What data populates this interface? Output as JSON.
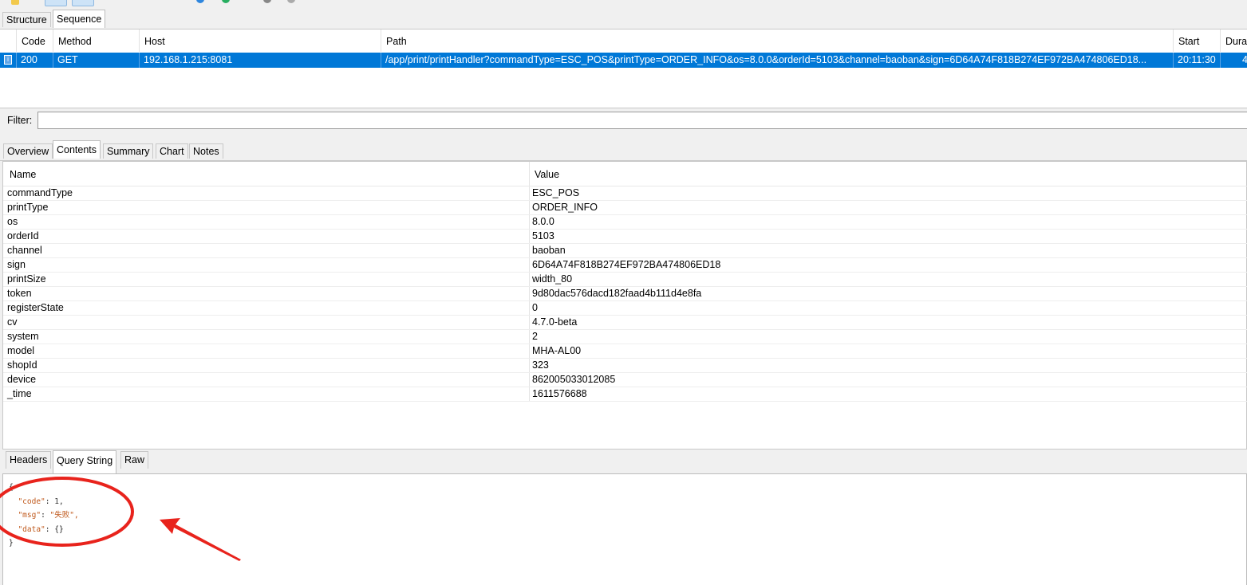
{
  "top_tabs": [
    "Structure",
    "Sequence"
  ],
  "active_top_tab": "Sequence",
  "sequence": {
    "columns": [
      "Code",
      "Method",
      "Host",
      "Path",
      "Start",
      "Dura"
    ],
    "row": {
      "code": "200",
      "method": "GET",
      "host": "192.168.1.215:8081",
      "path": "/app/print/printHandler?commandType=ESC_POS&printType=ORDER_INFO&os=8.0.0&orderId=5103&channel=baoban&sign=6D64A74F818B274EF972BA474806ED18...",
      "start": "20:11:30",
      "duration": "4"
    }
  },
  "filter": {
    "label": "Filter:",
    "value": ""
  },
  "detail_tabs": [
    "Overview",
    "Contents",
    "Summary",
    "Chart",
    "Notes"
  ],
  "active_detail_tab": "Contents",
  "params": {
    "columns": [
      "Name",
      "Value"
    ],
    "rows": [
      {
        "name": "commandType",
        "value": "ESC_POS"
      },
      {
        "name": "printType",
        "value": "ORDER_INFO"
      },
      {
        "name": "os",
        "value": "8.0.0"
      },
      {
        "name": "orderId",
        "value": "5103"
      },
      {
        "name": "channel",
        "value": "baoban"
      },
      {
        "name": "sign",
        "value": "6D64A74F818B274EF972BA474806ED18"
      },
      {
        "name": "printSize",
        "value": "width_80"
      },
      {
        "name": "token",
        "value": "9d80dac576dacd182faad4b111d4e8fa"
      },
      {
        "name": "registerState",
        "value": "0"
      },
      {
        "name": "cv",
        "value": "4.7.0-beta"
      },
      {
        "name": "system",
        "value": "2"
      },
      {
        "name": "model",
        "value": "MHA-AL00"
      },
      {
        "name": "shopId",
        "value": "323"
      },
      {
        "name": "device",
        "value": "862005033012085"
      },
      {
        "name": "_time",
        "value": "1611576688"
      }
    ]
  },
  "request_tabs": [
    "Headers",
    "Query String",
    "Raw"
  ],
  "active_request_tab": "Query String",
  "response": {
    "open": "{",
    "code_key": "\"code\"",
    "code_value": "1,",
    "msg_key": "\"msg\"",
    "msg_value": "\"失败\",",
    "data_key": "\"data\"",
    "data_value": "{}",
    "close": "}",
    "sep": ": "
  },
  "colors": {
    "selection": "#0078d7",
    "annotation": "#e8231c",
    "json_key": "#c0591c"
  }
}
